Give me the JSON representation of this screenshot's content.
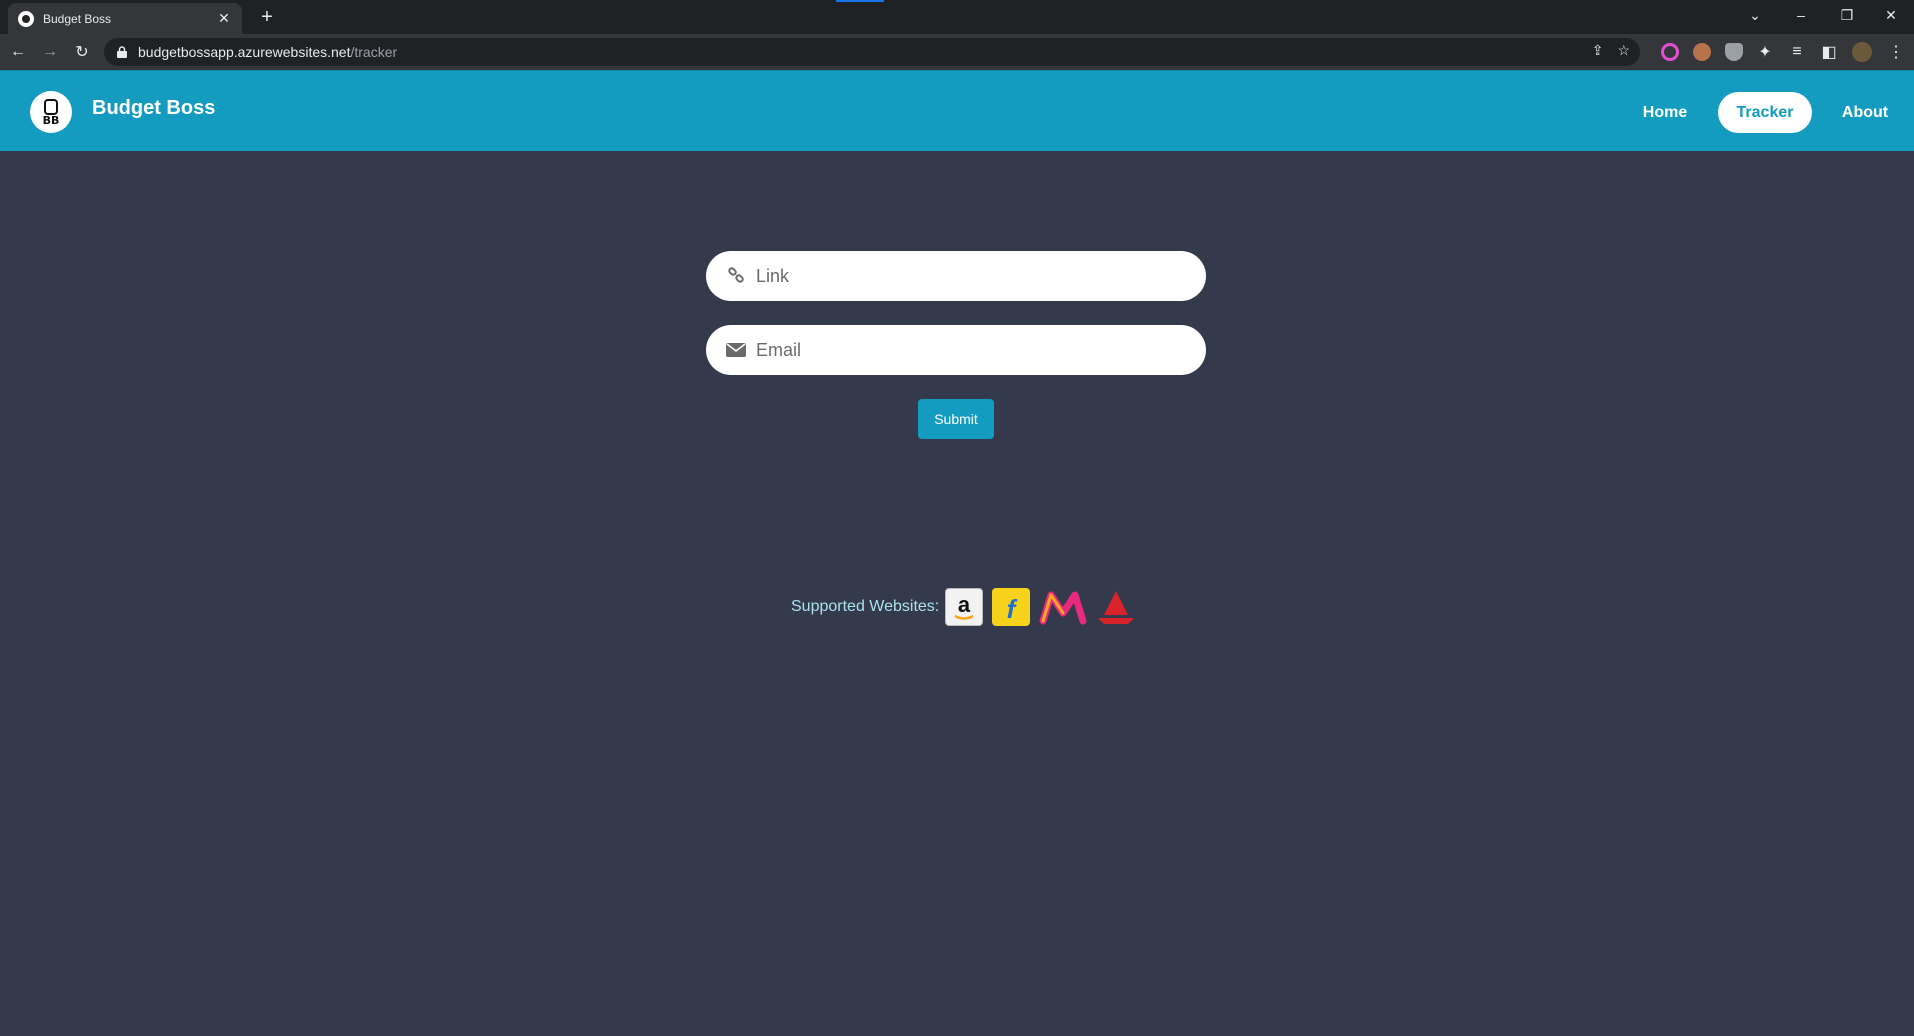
{
  "browser": {
    "tab_title": "Budget Boss",
    "url_host": "budgetbossapp.azurewebsites.net",
    "url_path": "/tracker"
  },
  "site": {
    "brand": "Budget Boss",
    "logo_text": "BB",
    "nav": [
      {
        "label": "Home",
        "active": false
      },
      {
        "label": "Tracker",
        "active": true
      },
      {
        "label": "About",
        "active": false
      }
    ],
    "accent_color": "#139cbf",
    "background_color": "#343a4b"
  },
  "form": {
    "link_placeholder": "Link",
    "email_placeholder": "Email",
    "submit_label": "Submit"
  },
  "supported": {
    "label": "Supported Websites:",
    "sites": [
      "amazon-logo",
      "flipkart-logo",
      "myntra-logo",
      "boat-logo"
    ]
  }
}
